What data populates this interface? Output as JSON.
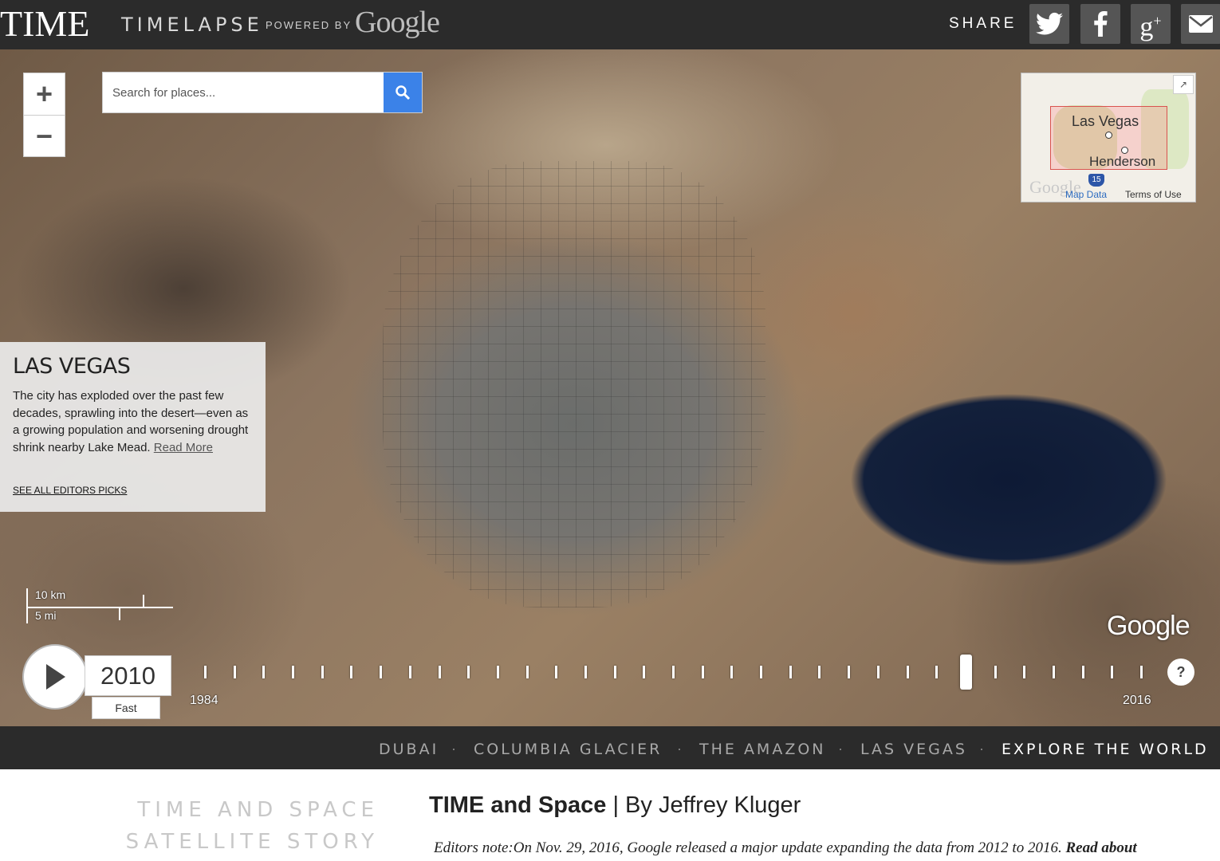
{
  "header": {
    "logo": "TIME",
    "product": "TIMELAPSE",
    "powered_by": "POWERED BY",
    "partner": "Google",
    "share_label": "SHARE",
    "share_buttons": [
      {
        "name": "twitter",
        "icon": "twitter-icon"
      },
      {
        "name": "facebook",
        "icon": "facebook-icon"
      },
      {
        "name": "google-plus",
        "icon": "google-plus-icon"
      },
      {
        "name": "email",
        "icon": "mail-icon"
      }
    ]
  },
  "map": {
    "zoom_in": "+",
    "zoom_out": "−",
    "search": {
      "placeholder": "Search for places..."
    },
    "minimap": {
      "city": "Las Vegas",
      "neighbor": "Henderson",
      "highway": "15",
      "watermark": "Google",
      "map_data": "Map Data",
      "terms": "Terms of Use"
    },
    "scale": {
      "km": "10 km",
      "mi": "5 mi"
    },
    "watermark": "Google"
  },
  "story": {
    "title": "LAS VEGAS",
    "text": "The city has exploded over the past few decades, sprawling into the desert—even as a growing population and worsening drought shrink nearby Lake Mead.",
    "read_more": "Read More",
    "see_all": "SEE ALL EDITORS PICKS"
  },
  "timeline": {
    "current_year": "2010",
    "speed": "Fast",
    "start_year": "1984",
    "end_year": "2016",
    "help": "?",
    "position_fraction": 0.8125
  },
  "nav": {
    "items": [
      {
        "label": "DUBAI",
        "active": false
      },
      {
        "label": "COLUMBIA GLACIER",
        "active": false
      },
      {
        "label": "THE AMAZON",
        "active": false
      },
      {
        "label": "LAS VEGAS",
        "active": false
      },
      {
        "label": "EXPLORE THE WORLD",
        "active": true
      }
    ],
    "separator": "·"
  },
  "article": {
    "side_line1": "TIME AND SPACE",
    "side_line2": "SATELLITE STORY",
    "title_bold": "TIME and Space",
    "title_rest": " | By Jeffrey Kluger",
    "note": "Editors note:On Nov. 29, 2016, Google released a major update expanding the data from 2012 to 2016.",
    "note_link": " Read about"
  }
}
